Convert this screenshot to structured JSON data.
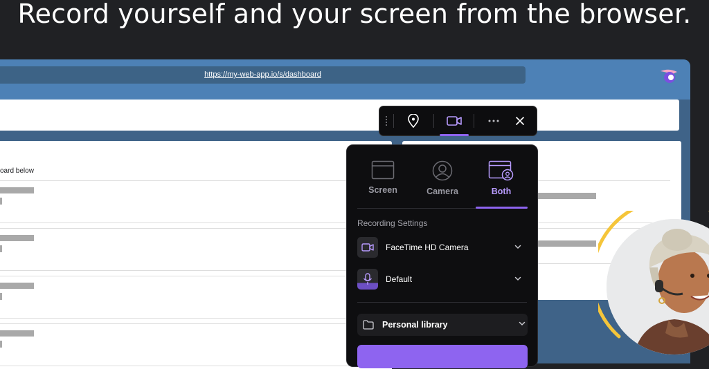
{
  "headline": "Record yourself and your screen from the browser.",
  "browser": {
    "url": "https://my-web-app.io/s/dashboard",
    "page_note": "oard below"
  },
  "toolbar": {
    "items": [
      "drag-handle",
      "pin-icon",
      "camera-video-icon",
      "more-icon",
      "close-icon"
    ],
    "active": "camera-video-icon"
  },
  "recorder": {
    "modes": [
      {
        "label": "Screen",
        "icon": "screen-icon",
        "active": false
      },
      {
        "label": "Camera",
        "icon": "user-circle-icon",
        "active": false
      },
      {
        "label": "Both",
        "icon": "screen-with-user-icon",
        "active": true
      }
    ],
    "settings_title": "Recording Settings",
    "camera": {
      "label": "FaceTime HD Camera",
      "icon": "video-camera-icon"
    },
    "microphone": {
      "label": "Default",
      "icon": "microphone-icon"
    },
    "library": {
      "label": "Personal library",
      "icon": "folder-icon"
    },
    "accent_color": "#8e64f0"
  },
  "colors": {
    "background": "#202124",
    "browser_chrome": "#4d81b6",
    "browser_body": "#3f6388",
    "panel": "#0e0e10",
    "ring": "#f5c53a"
  }
}
